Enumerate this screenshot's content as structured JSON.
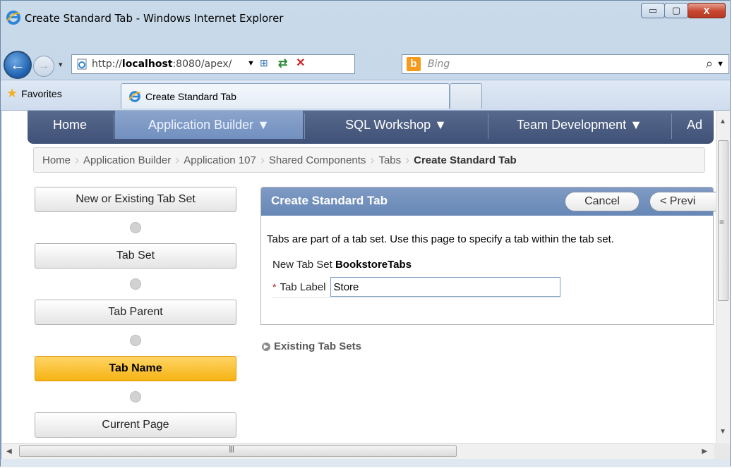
{
  "window": {
    "title": "Create Standard Tab - Windows Internet Explorer",
    "controls": {
      "minimize": "▭",
      "maximize": "▢",
      "close": "X"
    }
  },
  "address": {
    "url_prefix": "http://",
    "url_host": "localhost",
    "url_rest": ":8080/apex/",
    "search_placeholder": "Bing"
  },
  "favorites": {
    "label": "Favorites"
  },
  "tabs": [
    {
      "label": "Create Standard Tab"
    }
  ],
  "apex_nav": [
    {
      "label": "Home",
      "selected": false
    },
    {
      "label": "Application Builder ▼",
      "selected": true
    },
    {
      "label": "SQL Workshop ▼",
      "selected": false
    },
    {
      "label": "Team Development ▼",
      "selected": false
    },
    {
      "label": "Ad",
      "selected": false
    }
  ],
  "breadcrumb": [
    "Home",
    "Application Builder",
    "Application 107",
    "Shared Components",
    "Tabs",
    "Create Standard Tab"
  ],
  "wizard_steps": [
    {
      "label": "New or Existing Tab Set",
      "current": false
    },
    {
      "label": "Tab Set",
      "current": false
    },
    {
      "label": "Tab Parent",
      "current": false
    },
    {
      "label": "Tab Name",
      "current": true
    },
    {
      "label": "Current Page",
      "current": false
    }
  ],
  "region": {
    "title": "Create Standard Tab",
    "cancel_label": "Cancel",
    "previous_label": "< Previ",
    "instructions": "Tabs are part of a tab set. Use this page to specify a tab within the tab set.",
    "new_tab_set_label": "New Tab Set",
    "new_tab_set_value": "BookstoreTabs",
    "required_mark": "*",
    "tab_label_label": "Tab Label",
    "tab_label_value": "Store"
  },
  "existing_link": {
    "label": "Existing Tab Sets"
  }
}
